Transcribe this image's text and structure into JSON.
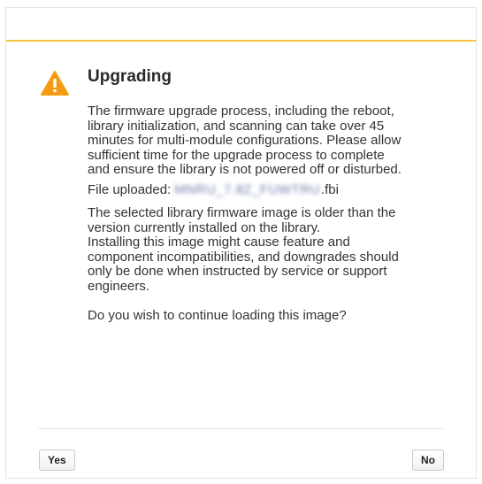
{
  "dialog": {
    "title": "Upgrading",
    "icon": "warning-triangle-icon",
    "accent_color": "#f4c542",
    "icon_color": "#f39c12",
    "message_lines": [
      "The firmware upgrade process, including the reboot,",
      "library initialization, and scanning can take over 45",
      "minutes for multi-module configurations. Please allow",
      "sufficient time for the upgrade process to complete",
      "and ensure the library is not powered off or disturbed."
    ],
    "file_uploaded_label": "File uploaded:",
    "file_name_redacted": "MNRU_7.8Z_FUWTRU",
    "file_extension": ".fbi",
    "version_warning_lines": [
      "The selected library firmware image is older than the",
      "version currently installed on the library."
    ],
    "incompatibility_lines": [
      "Installing this image might cause feature and",
      "component incompatibilities, and downgrades should",
      "only be done when instructed by service or support",
      "engineers."
    ],
    "question": "Do you wish to continue loading this image?"
  },
  "buttons": {
    "yes_label": "Yes",
    "no_label": "No"
  }
}
